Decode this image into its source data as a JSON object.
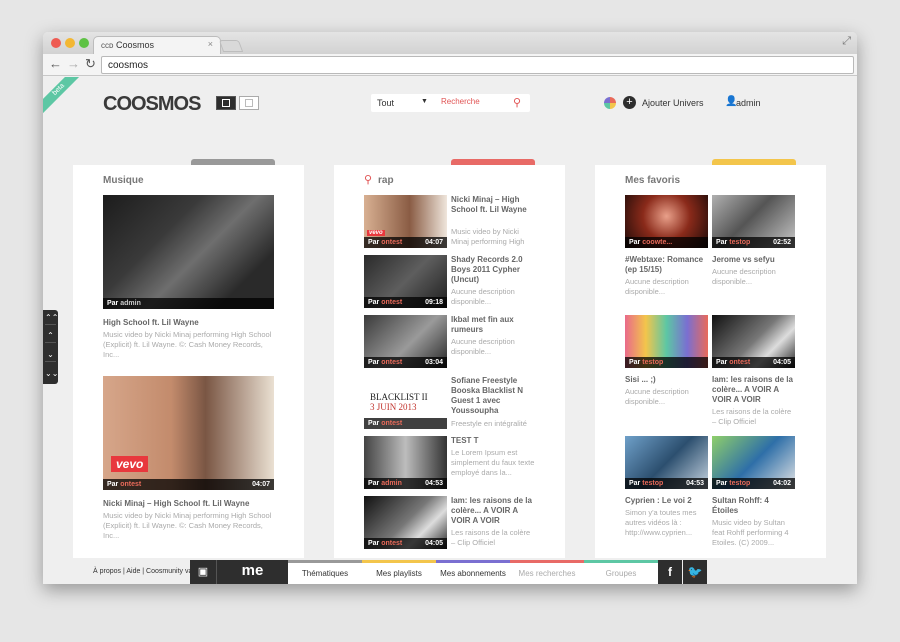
{
  "browser": {
    "tab_title": "Coosmos",
    "tab_icon": "coosmos-favicon",
    "url": "coosmos"
  },
  "header": {
    "logo": "COOSMOS",
    "badge": "beta",
    "search_scope": "Tout",
    "search_placeholder": "Recherche",
    "add_univers": "Ajouter Univers",
    "user": "admin"
  },
  "columns": [
    {
      "title": "Musique",
      "accent": "#999999",
      "videos": [
        {
          "by_prefix": "Par",
          "by": "admin",
          "duration": "",
          "title": "High School ft. Lil Wayne",
          "desc": "Music video by Nicki Minaj performing High School (Explicit) ft. Lil Wayne. ©: Cash Money Records, Inc..."
        },
        {
          "by_prefix": "Par",
          "by": "ontest",
          "duration": "04:07",
          "title": "Nicki Minaj – High School ft. Lil Wayne",
          "desc": "Music video by Nicki Minaj performing High School (Explicit) ft. Lil Wayne. ©: Cash Money Records, Inc...",
          "logo": "vevo"
        }
      ]
    },
    {
      "title": "rap",
      "accent": "#e86a66",
      "videos": [
        {
          "by_prefix": "Par",
          "by": "ontest",
          "duration": "04:07",
          "title": "Nicki Minaj – High School ft. Lil Wayne",
          "desc": "Music video by Nicki Minaj performing High"
        },
        {
          "by_prefix": "Par",
          "by": "ontest",
          "duration": "09:18",
          "title": "Shady Records 2.0 Boys 2011 Cypher (Uncut)",
          "desc": "Aucune description disponible..."
        },
        {
          "by_prefix": "Par",
          "by": "ontest",
          "duration": "03:04",
          "title": "Ikbal met fin aux rumeurs",
          "desc": "Aucune description disponible..."
        },
        {
          "by_prefix": "Par",
          "by": "ontest",
          "duration": "",
          "title": "Sofiane Freestyle Booska Blacklist N Guest 1 avec Youssoupha",
          "desc": "Freestyle en intégralité",
          "poster_line1": "BLACKLIST II",
          "poster_line2": "3 JUIN 2013"
        },
        {
          "by_prefix": "Par",
          "by": "admin",
          "duration": "04:53",
          "title": "TEST T",
          "desc": "Le Lorem Ipsum est simplement du faux texte employé dans la..."
        },
        {
          "by_prefix": "Par",
          "by": "ontest",
          "duration": "04:05",
          "title": "Iam: les raisons de la colère... A VOIR A VOIR A VOIR",
          "desc": "Les raisons de la colère – Clip Officiel"
        }
      ]
    },
    {
      "title": "Mes favoris",
      "accent": "#f3c54b",
      "videos": [
        {
          "by_prefix": "Par",
          "by": "coowte...",
          "duration": "",
          "title": "#Webtaxe: Romance (ep 15/15)",
          "desc": "Aucune description disponible..."
        },
        {
          "by_prefix": "Par",
          "by": "testop",
          "duration": "02:52",
          "title": "Jerome vs sefyu",
          "desc": "Aucune description disponible..."
        },
        {
          "by_prefix": "Par",
          "by": "testop",
          "duration": "",
          "title": "Sisi ... ;)",
          "desc": "Aucune description disponible..."
        },
        {
          "by_prefix": "Par",
          "by": "ontest",
          "duration": "04:05",
          "title": "Iam: les raisons de la colère... A VOIR A VOIR A VOIR",
          "desc": "Les raisons de la colère – Clip Officiel"
        },
        {
          "by_prefix": "Par",
          "by": "testop",
          "duration": "04:53",
          "title": "Cyprien : Le voi 2",
          "desc": "Simon y'a toutes mes autres vidéos là : http://www.cyprien..."
        },
        {
          "by_prefix": "Par",
          "by": "testop",
          "duration": "04:02",
          "title": "Sultan Rohff: 4 Étoiles",
          "desc": "Music video by Sultan feat Rohff performing 4 Etoiles. (C) 2009..."
        }
      ]
    }
  ],
  "footer": {
    "links": "À propos | Aide | Coosmunity valeurs | CGU | Contactez nous"
  },
  "bottombar": {
    "me": "me",
    "tabs": [
      {
        "label": "Thématiques",
        "color": "#999999"
      },
      {
        "label": "Mes playlists",
        "color": "#f3c54b"
      },
      {
        "label": "Mes abonnements",
        "color": "#7a6fd1"
      },
      {
        "label": "Mes recherches",
        "color": "#e86a66"
      },
      {
        "label": "Groupes",
        "color": "#5dc7a4"
      }
    ],
    "social": [
      "f",
      "t"
    ]
  },
  "colors": {
    "accent_red": "#e15454",
    "dark": "#2e2e2e"
  }
}
